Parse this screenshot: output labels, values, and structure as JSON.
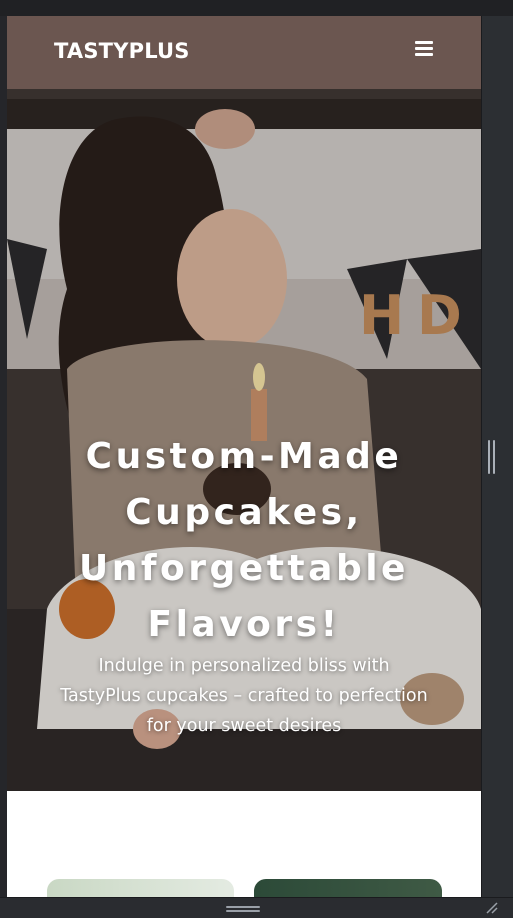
{
  "navbar": {
    "brand": "TASTYPLUS",
    "menu_icon": "hamburger-menu-icon"
  },
  "hero": {
    "title": "Custom-Made Cupcakes, Unforgettable Flavors!",
    "subtitle": "Indulge in personalized bliss with TastyPlus cupcakes – crafted to perfection for your sweet desires",
    "background_image": "girl-with-birthday-cupcake-and-number-4-candle"
  },
  "cards": [
    {
      "name": "card-light-green"
    },
    {
      "name": "card-dark-green"
    }
  ],
  "colors": {
    "navbar_bg": "#6b5650",
    "hero_text": "#ffffff",
    "page_bg": "#ffffff",
    "browser_chrome": "#2c2f33"
  }
}
